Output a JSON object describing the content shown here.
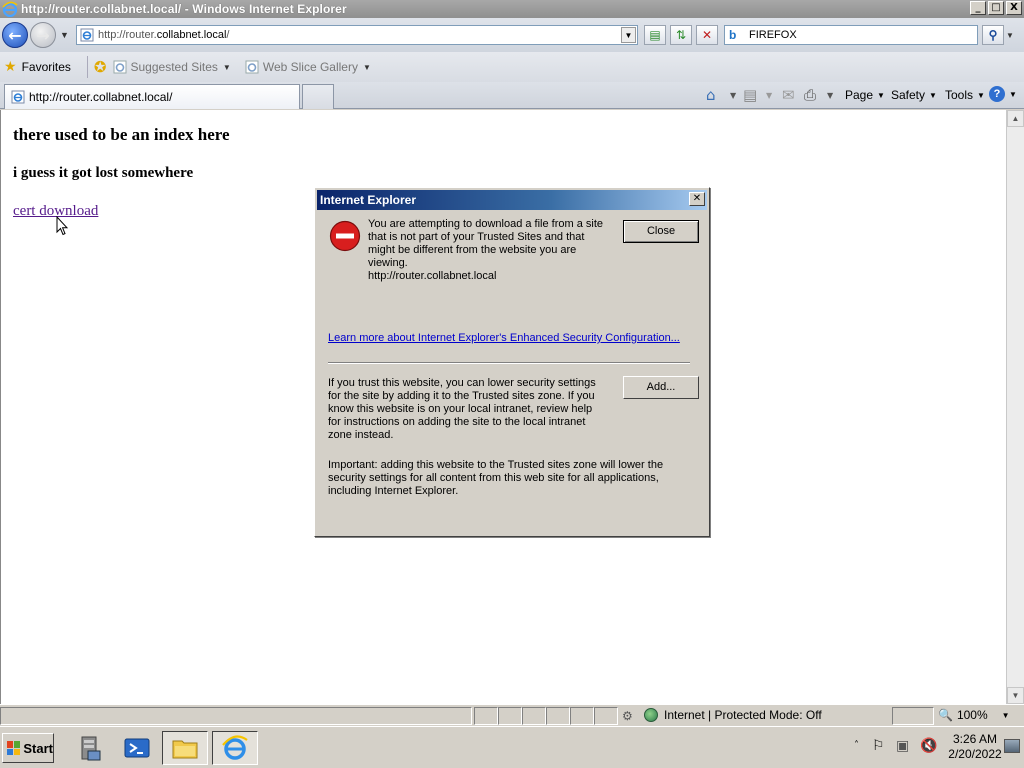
{
  "window": {
    "title": "http://router.collabnet.local/ - Windows Internet Explorer",
    "minimize": "_",
    "maximize": "□",
    "close": "X"
  },
  "address": {
    "url_prefix": "http://router.",
    "url_domain": "collabnet.local",
    "url_suffix": "/"
  },
  "search": {
    "value": "FIREFOX"
  },
  "favorites_bar": {
    "favorites_label": "Favorites",
    "suggested_sites_label": "Suggested Sites",
    "web_slice_gallery_label": "Web Slice Gallery"
  },
  "tabs": {
    "active_label": "http://router.collabnet.local/"
  },
  "command_bar": {
    "page_label": "Page",
    "safety_label": "Safety",
    "tools_label": "Tools"
  },
  "page": {
    "heading": "there used to be an index here",
    "subheading": "i guess it got lost somewhere",
    "link_text": "cert download"
  },
  "dialog": {
    "title": "Internet Explorer",
    "message": "You are attempting to download a file from a site that is not part of your Trusted Sites and that might be different from the website you are viewing.",
    "site": "http://router.collabnet.local",
    "close_label": "Close",
    "learn_more": "Learn more about Internet Explorer's Enhanced Security Configuration...",
    "trust_text": "If you trust this website, you can lower security settings for the site by adding it to the Trusted sites zone. If you know this website is on your local intranet, review help for instructions on adding the site to the local intranet zone instead.",
    "add_label": "Add...",
    "important_text": "Important: adding this website to the Trusted sites zone will lower the security settings for all content from this web site for all applications, including Internet Explorer."
  },
  "status_bar": {
    "zone_text": "Internet | Protected Mode: Off",
    "zoom_text": "100%"
  },
  "taskbar": {
    "start_label": "Start",
    "clock_time": "3:26 AM",
    "clock_date": "2/20/2022"
  }
}
